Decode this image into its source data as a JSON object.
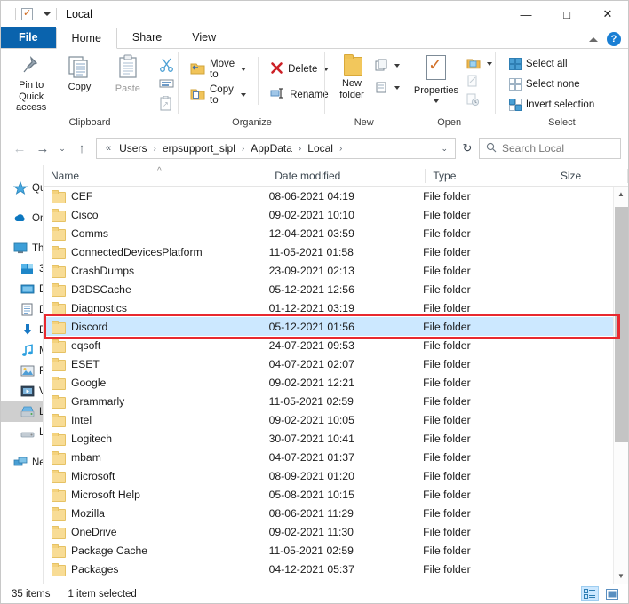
{
  "window": {
    "title": "Local",
    "quick_access": [
      "folder-icon",
      "properties-icon",
      "new-folder-icon",
      "customize-caret"
    ],
    "controls": {
      "minimize": "—",
      "maximize": "□",
      "close": "✕"
    }
  },
  "tabs": [
    {
      "label": "File",
      "state": "file-menu"
    },
    {
      "label": "Home",
      "state": "active"
    },
    {
      "label": "Share",
      "state": "inactive"
    },
    {
      "label": "View",
      "state": "inactive"
    }
  ],
  "tabbar_right": {
    "collapse_icon": "caret-up",
    "help_icon": "?"
  },
  "ribbon": {
    "groups": [
      {
        "label": "Clipboard",
        "big_buttons": [
          {
            "label": "Pin to Quick access",
            "icon": "pin-icon"
          },
          {
            "label": "Copy",
            "icon": "copy-icon"
          },
          {
            "label": "Paste",
            "icon": "paste-icon"
          }
        ],
        "small_icons": [
          "cut-icon",
          "copy-path-icon",
          "paste-shortcut-icon"
        ]
      },
      {
        "label": "Organize",
        "small_buttons": [
          {
            "label": "Move to",
            "icon": "move-to-icon",
            "has_caret": true
          },
          {
            "label": "Copy to",
            "icon": "copy-to-icon",
            "has_caret": true
          },
          {
            "label": "Delete",
            "icon": "delete-icon",
            "has_caret": true
          },
          {
            "label": "Rename",
            "icon": "rename-icon",
            "has_caret": false
          }
        ]
      },
      {
        "label": "New",
        "big_buttons": [
          {
            "label": "New folder",
            "icon": "new-folder-icon"
          }
        ],
        "small_icons": [
          "new-item-icon",
          "easy-access-icon"
        ]
      },
      {
        "label": "Open",
        "big_buttons": [
          {
            "label": "Properties",
            "icon": "properties-icon",
            "has_caret": true
          }
        ],
        "small_icons": [
          "open-icon",
          "edit-icon",
          "history-icon"
        ]
      },
      {
        "label": "Select",
        "small_buttons": [
          {
            "label": "Select all",
            "icon": "select-all-icon"
          },
          {
            "label": "Select none",
            "icon": "select-none-icon"
          },
          {
            "label": "Invert selection",
            "icon": "invert-selection-icon"
          }
        ]
      }
    ]
  },
  "addressbar": {
    "back": "←",
    "forward": "→",
    "recent": "⌄",
    "up": "↑",
    "folder_icon": "folder-icon",
    "prefix": "«",
    "crumbs": [
      "Users",
      "erpsupport_sipl",
      "AppData",
      "Local"
    ],
    "separator": "›",
    "dropdown": "⌄",
    "refresh": "↻",
    "search_placeholder": "Search Local",
    "search_icon": "search-icon"
  },
  "navpane": {
    "items": [
      {
        "label": "Qu",
        "icon": "star-icon",
        "indent": false,
        "selected": false
      },
      {
        "label": "On",
        "icon": "cloud-icon",
        "indent": false,
        "selected": false,
        "gap_before": true
      },
      {
        "label": "Th",
        "icon": "this-pc-icon",
        "indent": false,
        "selected": false,
        "gap_before": true
      },
      {
        "label": "3",
        "icon": "drive-3d-icon",
        "indent": true,
        "selected": false
      },
      {
        "label": "D",
        "icon": "desktop-icon",
        "indent": true,
        "selected": false
      },
      {
        "label": "D",
        "icon": "documents-icon",
        "indent": true,
        "selected": false
      },
      {
        "label": "D",
        "icon": "downloads-icon",
        "indent": true,
        "selected": false
      },
      {
        "label": "M",
        "icon": "music-icon",
        "indent": true,
        "selected": false
      },
      {
        "label": "P",
        "icon": "pictures-icon",
        "indent": true,
        "selected": false
      },
      {
        "label": "V",
        "icon": "videos-icon",
        "indent": true,
        "selected": false
      },
      {
        "label": "L",
        "icon": "local-disk-icon",
        "indent": true,
        "selected": true
      },
      {
        "label": "L",
        "icon": "local-disk-icon",
        "indent": true,
        "selected": false
      },
      {
        "label": "Ne",
        "icon": "network-icon",
        "indent": false,
        "selected": false,
        "gap_before": true
      }
    ]
  },
  "filelist": {
    "columns": [
      "Name",
      "Date modified",
      "Type",
      "Size"
    ],
    "sort_indicator": "^",
    "rows": [
      {
        "name": "CEF",
        "date": "08-06-2021 04:19",
        "type": "File folder",
        "size": "",
        "selected": false
      },
      {
        "name": "Cisco",
        "date": "09-02-2021 10:10",
        "type": "File folder",
        "size": "",
        "selected": false
      },
      {
        "name": "Comms",
        "date": "12-04-2021 03:59",
        "type": "File folder",
        "size": "",
        "selected": false
      },
      {
        "name": "ConnectedDevicesPlatform",
        "date": "11-05-2021 01:58",
        "type": "File folder",
        "size": "",
        "selected": false
      },
      {
        "name": "CrashDumps",
        "date": "23-09-2021 02:13",
        "type": "File folder",
        "size": "",
        "selected": false
      },
      {
        "name": "D3DSCache",
        "date": "05-12-2021 12:56",
        "type": "File folder",
        "size": "",
        "selected": false
      },
      {
        "name": "Diagnostics",
        "date": "01-12-2021 03:19",
        "type": "File folder",
        "size": "",
        "selected": false
      },
      {
        "name": "Discord",
        "date": "05-12-2021 01:56",
        "type": "File folder",
        "size": "",
        "selected": true
      },
      {
        "name": "eqsoft",
        "date": "24-07-2021 09:53",
        "type": "File folder",
        "size": "",
        "selected": false
      },
      {
        "name": "ESET",
        "date": "04-07-2021 02:07",
        "type": "File folder",
        "size": "",
        "selected": false
      },
      {
        "name": "Google",
        "date": "09-02-2021 12:21",
        "type": "File folder",
        "size": "",
        "selected": false
      },
      {
        "name": "Grammarly",
        "date": "11-05-2021 02:59",
        "type": "File folder",
        "size": "",
        "selected": false
      },
      {
        "name": "Intel",
        "date": "09-02-2021 10:05",
        "type": "File folder",
        "size": "",
        "selected": false
      },
      {
        "name": "Logitech",
        "date": "30-07-2021 10:41",
        "type": "File folder",
        "size": "",
        "selected": false
      },
      {
        "name": "mbam",
        "date": "04-07-2021 01:37",
        "type": "File folder",
        "size": "",
        "selected": false
      },
      {
        "name": "Microsoft",
        "date": "08-09-2021 01:20",
        "type": "File folder",
        "size": "",
        "selected": false
      },
      {
        "name": "Microsoft Help",
        "date": "05-08-2021 10:15",
        "type": "File folder",
        "size": "",
        "selected": false
      },
      {
        "name": "Mozilla",
        "date": "08-06-2021 11:29",
        "type": "File folder",
        "size": "",
        "selected": false
      },
      {
        "name": "OneDrive",
        "date": "09-02-2021 11:30",
        "type": "File folder",
        "size": "",
        "selected": false
      },
      {
        "name": "Package Cache",
        "date": "11-05-2021 02:59",
        "type": "File folder",
        "size": "",
        "selected": false
      },
      {
        "name": "Packages",
        "date": "04-12-2021 05:37",
        "type": "File folder",
        "size": "",
        "selected": false
      }
    ]
  },
  "highlight": {
    "color": "#e8292f",
    "target_row": "Discord"
  },
  "statusbar": {
    "item_count": "35 items",
    "selection": "1 item selected",
    "view_details": "details-view-icon",
    "view_large": "large-icons-view-icon"
  },
  "colors": {
    "accent": "#0a63ad",
    "selection": "#cce8ff",
    "highlight_red": "#e8292f",
    "folder_yellow": "#f8dc95"
  }
}
